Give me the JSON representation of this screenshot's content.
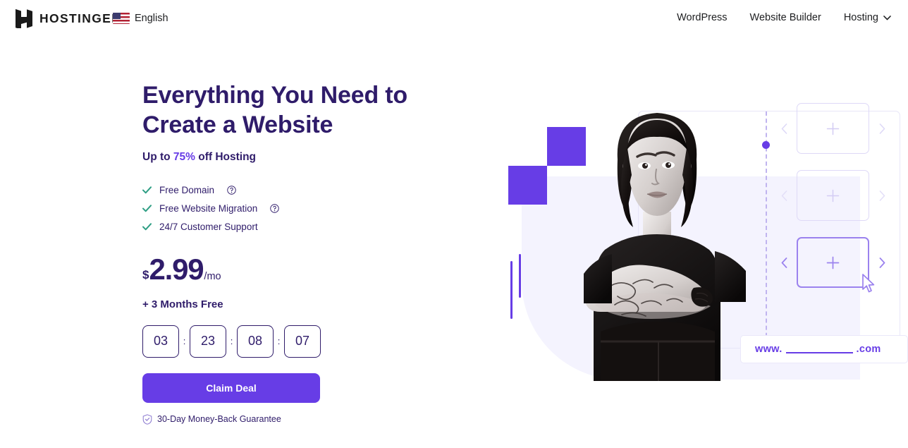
{
  "header": {
    "brand_name": "HOSTINGER",
    "logo_icon": "hostinger-h-logo",
    "language": {
      "flag_icon": "us-flag-icon",
      "label": "English"
    },
    "nav_items": [
      {
        "label": "WordPress",
        "has_chevron": false
      },
      {
        "label": "Website Builder",
        "has_chevron": false
      },
      {
        "label": "Hosting",
        "has_chevron": true
      }
    ],
    "chevron_icon": "chevron-down-icon"
  },
  "hero": {
    "headline_line1": "Everything You Need to",
    "headline_line2": "Create a Website",
    "subhead_prefix": "Up to ",
    "subhead_percent": "75%",
    "subhead_suffix": " off Hosting",
    "features": [
      {
        "label": "Free Domain",
        "check_icon": "check-icon",
        "help_icon": "question-circle-icon",
        "has_help": true
      },
      {
        "label": "Free Website Migration",
        "check_icon": "check-icon",
        "help_icon": "question-circle-icon",
        "has_help": true
      },
      {
        "label": "24/7 Customer Support",
        "check_icon": "check-icon",
        "help_icon": "",
        "has_help": false
      }
    ],
    "price": {
      "currency": "$",
      "amount": "2.99",
      "period": "/mo"
    },
    "bonus": "+ 3 Months Free",
    "timer": {
      "separator": ":",
      "units": [
        "03",
        "23",
        "08",
        "07"
      ]
    },
    "cta_label": "Claim Deal",
    "guarantee": {
      "icon": "shield-check-icon",
      "label": "30-Day Money-Back Guarantee"
    }
  },
  "illustration": {
    "url_prefix": "www.",
    "url_suffix": ".com",
    "window_dots_count": 3,
    "cards": [
      {
        "plus_icon": "plus-icon",
        "prev_icon": "chevron-left-icon",
        "next_icon": "chevron-right-icon",
        "active": false
      },
      {
        "plus_icon": "plus-icon",
        "prev_icon": "chevron-left-icon",
        "next_icon": "chevron-right-icon",
        "active": false
      },
      {
        "plus_icon": "plus-icon",
        "prev_icon": "chevron-left-icon",
        "next_icon": "chevron-right-icon",
        "active": true
      }
    ],
    "cursor_icon": "mouse-cursor-icon"
  },
  "colors": {
    "brand_purple": "#673de6",
    "deep_purple": "#2f1c6a",
    "check_teal": "#2e9e84",
    "lavender_bg": "#f4f3fe",
    "card_border": "#ded9f7"
  }
}
